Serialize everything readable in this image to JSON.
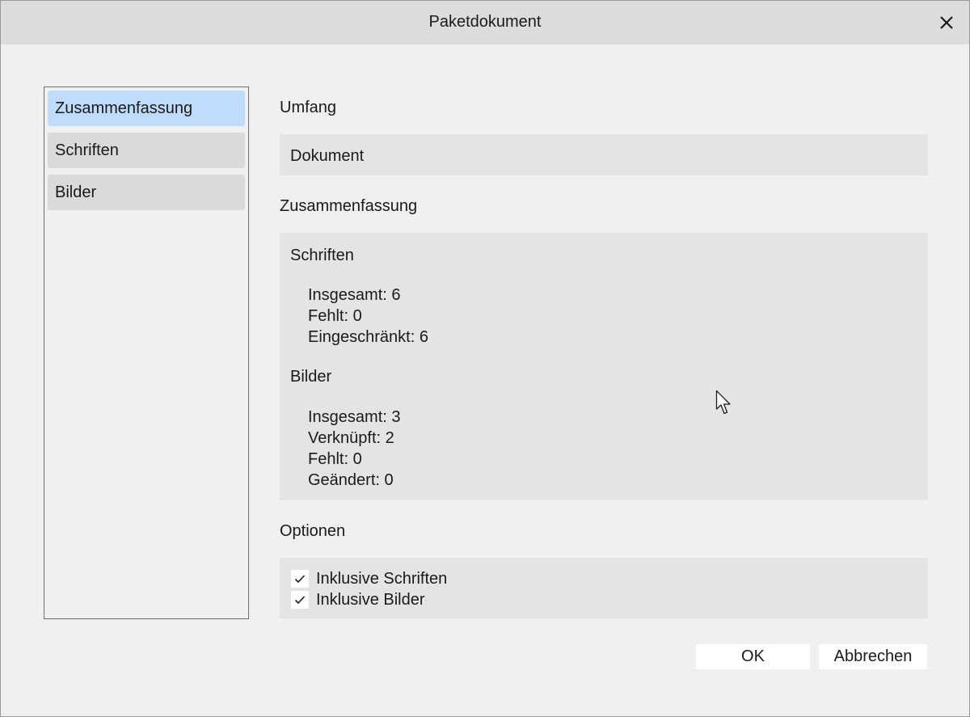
{
  "dialog": {
    "title": "Paketdokument"
  },
  "sidebar": {
    "items": [
      {
        "label": "Zusammenfassung",
        "selected": true
      },
      {
        "label": "Schriften",
        "selected": false
      },
      {
        "label": "Bilder",
        "selected": false
      }
    ]
  },
  "scope": {
    "heading": "Umfang",
    "value": "Dokument"
  },
  "summary": {
    "heading": "Zusammenfassung",
    "fonts": {
      "heading": "Schriften",
      "total": "Insgesamt: 6",
      "missing": "Fehlt: 0",
      "restricted": "Eingeschränkt: 6"
    },
    "images": {
      "heading": "Bilder",
      "total": "Insgesamt: 3",
      "linked": "Verknüpft: 2",
      "missing": "Fehlt: 0",
      "modified": "Geändert: 0"
    }
  },
  "options": {
    "heading": "Optionen",
    "include_fonts": {
      "label": "Inklusive Schriften",
      "checked": true
    },
    "include_images": {
      "label": "Inklusive Bilder",
      "checked": true
    }
  },
  "buttons": {
    "ok": "OK",
    "cancel": "Abbrechen"
  },
  "icons": {
    "close": "close-icon",
    "check": "checkmark-icon",
    "cursor": "mouse-pointer-icon"
  }
}
